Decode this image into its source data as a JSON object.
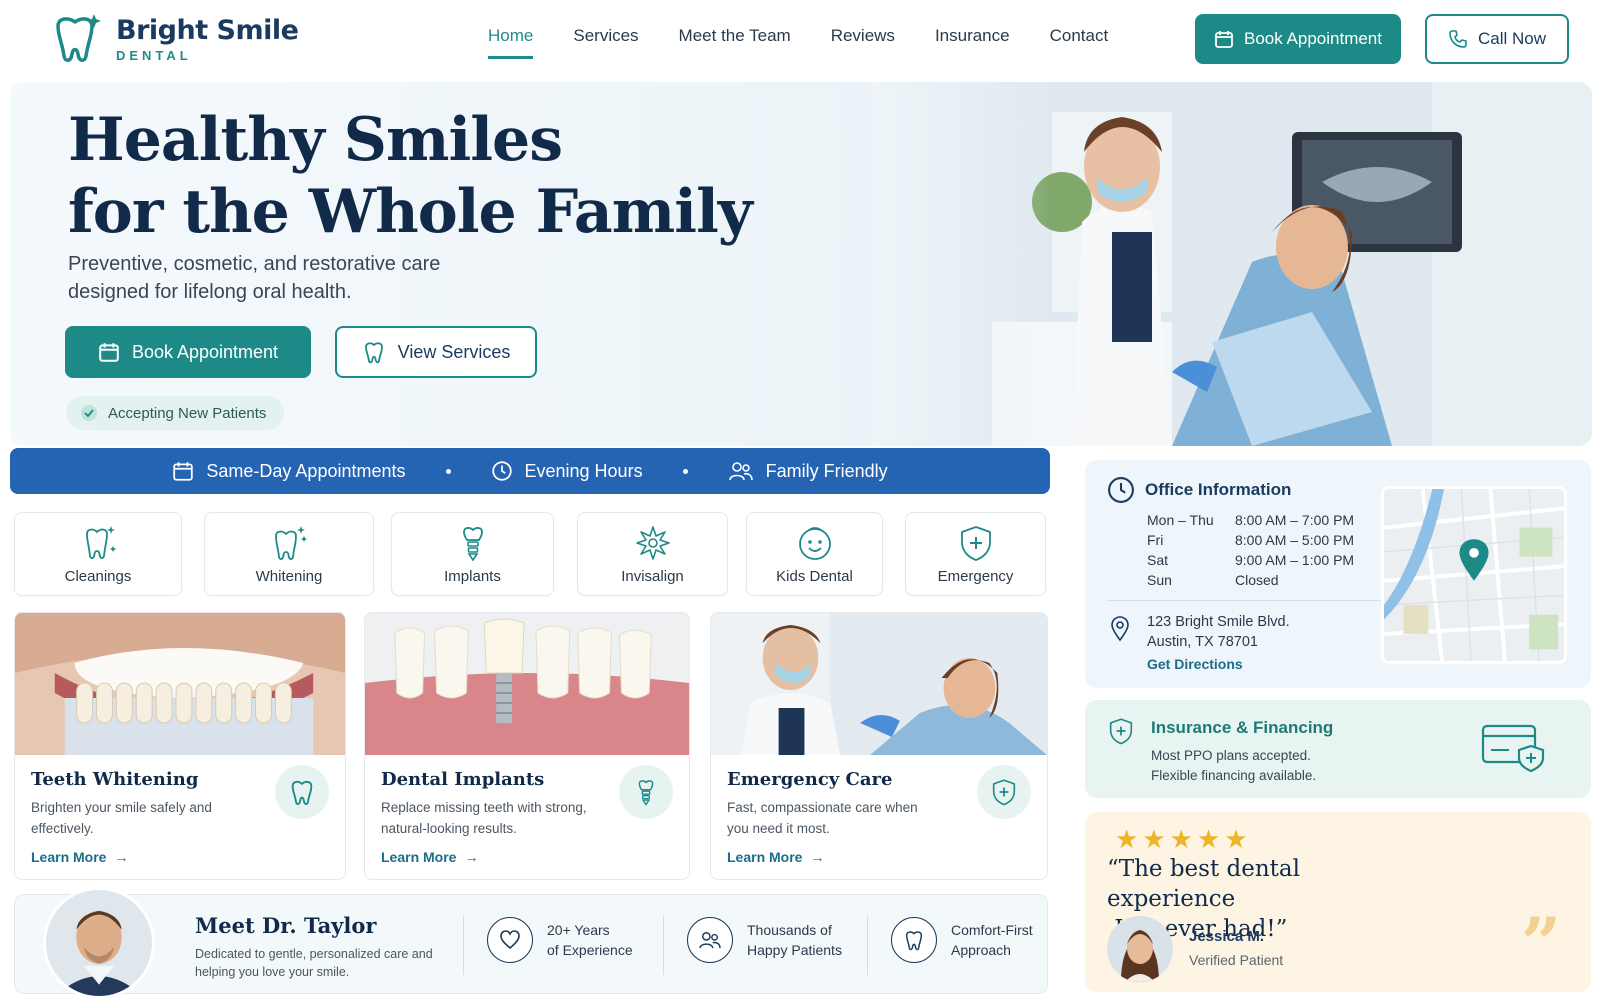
{
  "brand": {
    "name": "Bright Smile",
    "subtitle": "DENTAL",
    "accent": "#1d8a88",
    "navy": "#112a4a",
    "blue_bar": "#2563b3"
  },
  "nav": {
    "items": [
      "Home",
      "Services",
      "Meet the Team",
      "Reviews",
      "Insurance",
      "Contact"
    ],
    "active": "Home",
    "book_label": "Book Appointment",
    "call_label": "Call Now"
  },
  "hero": {
    "title_line1": "Healthy Smiles",
    "title_line2": "for the Whole Family",
    "subtitle_line1": "Preventive, cosmetic, and restorative care",
    "subtitle_line2": "designed for lifelong oral health.",
    "primary_cta": "Book Appointment",
    "secondary_cta": "View Services",
    "badge": "Accepting New Patients"
  },
  "features": [
    "Same-Day Appointments",
    "Evening Hours",
    "Family Friendly"
  ],
  "services": [
    {
      "label": "Cleanings",
      "icon": "tooth-sparkle-icon"
    },
    {
      "label": "Whitening",
      "icon": "tooth-shine-icon"
    },
    {
      "label": "Implants",
      "icon": "implant-icon"
    },
    {
      "label": "Invisalign",
      "icon": "aligner-icon"
    },
    {
      "label": "Kids Dental",
      "icon": "child-face-icon"
    },
    {
      "label": "Emergency",
      "icon": "shield-plus-icon"
    }
  ],
  "cards": [
    {
      "title": "Teeth Whitening",
      "desc": "Brighten your smile safely and effectively.",
      "link": "Learn More",
      "icon": "tooth-icon"
    },
    {
      "title": "Dental Implants",
      "desc": "Replace missing teeth with strong, natural-looking results.",
      "link": "Learn More",
      "icon": "implant-icon"
    },
    {
      "title": "Emergency Care",
      "desc": "Fast, compassionate care when you need it most.",
      "link": "Learn More",
      "icon": "shield-plus-icon"
    }
  ],
  "doctor": {
    "name": "Meet Dr. Taylor",
    "desc": "Dedicated to gentle, personalized care and helping you love your smile.",
    "stats": [
      {
        "line1": "20+ Years",
        "line2": "of Experience",
        "icon": "heart-icon"
      },
      {
        "line1": "Thousands of",
        "line2": "Happy Patients",
        "icon": "people-icon"
      },
      {
        "line1": "Comfort-First",
        "line2": "Approach",
        "icon": "tooth-icon"
      }
    ]
  },
  "office": {
    "title": "Office Information",
    "hours": [
      {
        "day": "Mon – Thu",
        "time": "8:00 AM – 7:00 PM"
      },
      {
        "day": "Fri",
        "time": "8:00 AM – 5:00 PM"
      },
      {
        "day": "Sat",
        "time": "9:00 AM – 1:00 PM"
      },
      {
        "day": "Sun",
        "time": "Closed"
      }
    ],
    "address_line1": "123 Bright Smile Blvd.",
    "address_line2": "Austin, TX 78701",
    "directions": "Get Directions"
  },
  "insurance": {
    "title": "Insurance & Financing",
    "line1": "Most PPO plans accepted.",
    "line2": "Flexible financing available."
  },
  "review": {
    "rating": 5,
    "quote_line1": "“The best dental experience",
    "quote_line2": "I’ve ever had!”",
    "name": "Jessica M.",
    "role": "Verified Patient"
  }
}
